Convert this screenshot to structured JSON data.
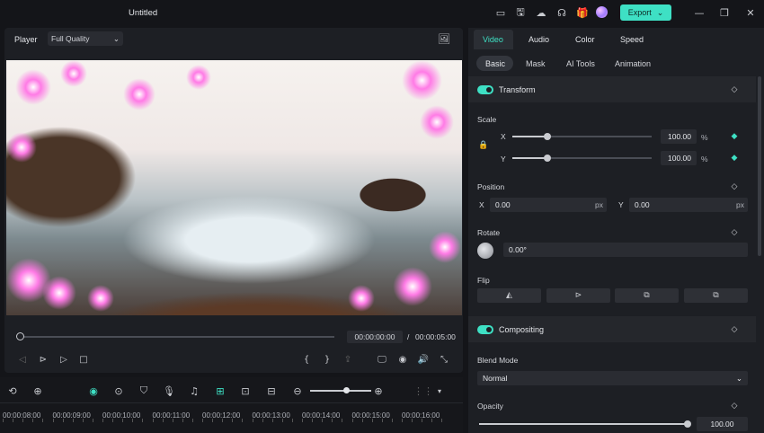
{
  "titlebar": {
    "title": "Untitled",
    "export_label": "Export",
    "export_caret": "⌄",
    "icons": [
      "layout-icon",
      "save-icon",
      "cloud-upload-icon",
      "support-icon",
      "gift-icon",
      "avatar",
      "minimize-icon",
      "maximize-icon",
      "close-icon"
    ],
    "glyphs": {
      "layout": "▭",
      "save": "🖫",
      "cloud": "☁",
      "support": "☊",
      "gift": "🎁",
      "minimize": "—",
      "maximize": "❐",
      "close": "✕"
    }
  },
  "player": {
    "label": "Player",
    "quality": "Full Quality",
    "quality_caret": "⌄",
    "snapshot_glyph": "🖼",
    "current_time": "00:00:00:00",
    "time_separator": "/",
    "total_time": "00:00:05:00",
    "progress": 0,
    "controls": {
      "prev_frame": "◁",
      "next_frame": "⊳",
      "play": "▷",
      "stop": "□",
      "mark_in": "{",
      "mark_out": "}",
      "render": "⇪",
      "display": "🖵",
      "camera": "◉",
      "volume": "🔊",
      "fullscreen": "⤡"
    }
  },
  "timeline": {
    "tools": {
      "ai": "⟲",
      "speed": "⊕",
      "record": "◉",
      "replace": "⊙",
      "marker": "⛉",
      "mic": "🎙",
      "music": "♫",
      "split": "⊞",
      "edit": "⊡",
      "subtitle": "⊟",
      "zoom_out": "⊖",
      "zoom_in": "⊕",
      "grid": "⋮⋮",
      "grid_caret": "▾"
    },
    "zoom_level": 0.55,
    "ticks": [
      "00:00:08:00",
      "00:00:09:00",
      "00:00:10:00",
      "00:00:11:00",
      "00:00:12:00",
      "00:00:13:00",
      "00:00:14:00",
      "00:00:15:00",
      "00:00:16:00"
    ]
  },
  "props": {
    "tabs": [
      "Video",
      "Audio",
      "Color",
      "Speed"
    ],
    "active_tab": "Video",
    "subtabs": [
      "Basic",
      "Mask",
      "AI Tools",
      "Animation"
    ],
    "active_subtab": "Basic",
    "transform": {
      "title": "Transform",
      "enabled": true,
      "scale_label": "Scale",
      "x_label": "X",
      "y_label": "Y",
      "scale_x": "100.00",
      "scale_y": "100.00",
      "scale_unit": "%",
      "scale_level": 0.25,
      "position_label": "Position",
      "pos_x": "0.00",
      "pos_y": "0.00",
      "pos_unit": "px",
      "rotate_label": "Rotate",
      "rotate_value": "0.00°",
      "flip_label": "Flip",
      "flip_glyphs": [
        "◭",
        "⊳",
        "⧉",
        "⧉"
      ]
    },
    "compositing": {
      "title": "Compositing",
      "enabled": true,
      "blend_label": "Blend Mode",
      "blend_value": "Normal",
      "opacity_label": "Opacity",
      "opacity_value": "100.00",
      "opacity_level": 1.0
    },
    "keyframe_glyph": "◇",
    "keyframe_active_glyph": "◆"
  },
  "colors": {
    "accent": "#3ee0c4",
    "panel": "#1d1f24",
    "bg": "#141519"
  }
}
